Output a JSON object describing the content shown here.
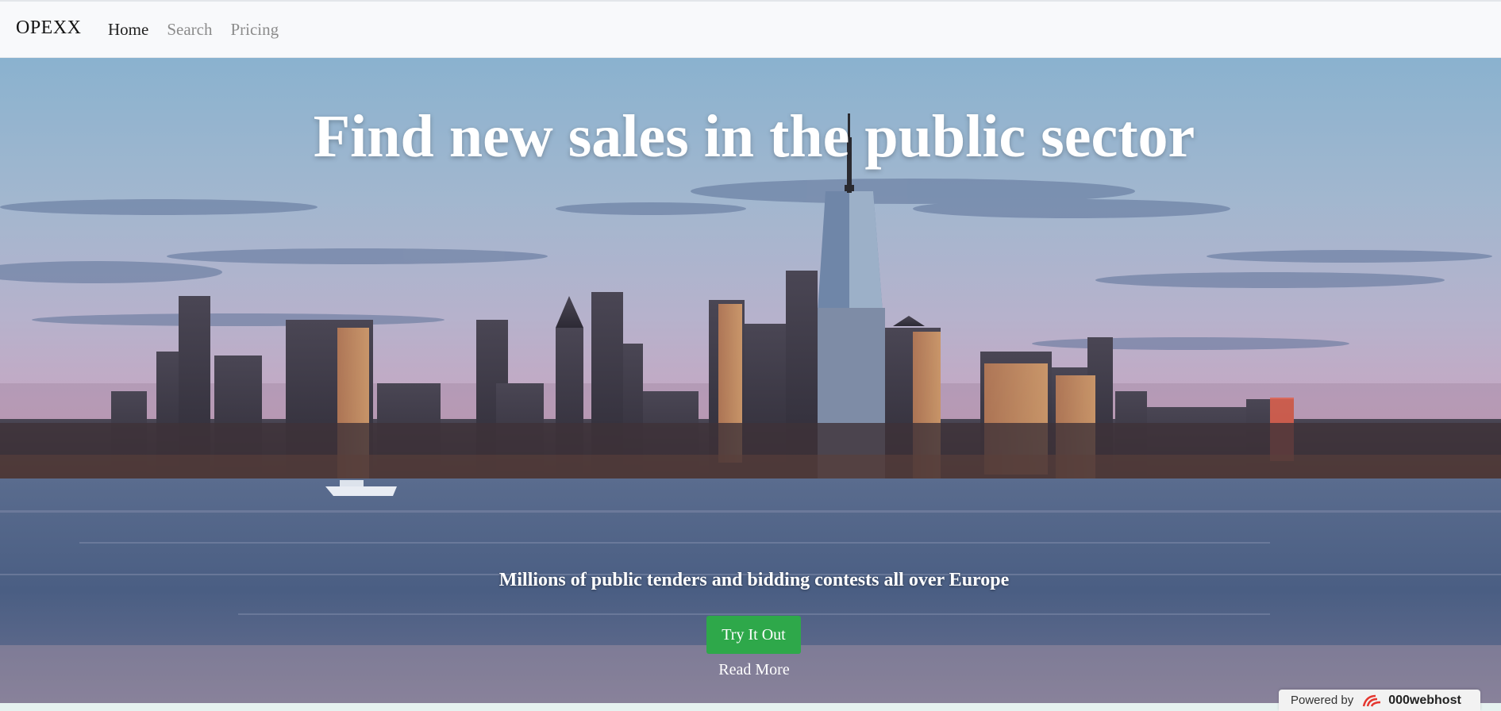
{
  "nav": {
    "brand": "OPEXX",
    "links": [
      {
        "label": "Home",
        "active": true
      },
      {
        "label": "Search",
        "active": false
      },
      {
        "label": "Pricing",
        "active": false
      }
    ]
  },
  "hero": {
    "title": "Find new sales in the public sector",
    "subtitle": "Millions of public tenders and bidding contests all over Europe",
    "cta_label": "Try It Out",
    "read_more_label": "Read More"
  },
  "badge": {
    "prefix": "Powered by",
    "brand": "000webhost"
  },
  "colors": {
    "cta": "#2ea84a",
    "nav_bg": "#f8f9fb",
    "nav_active": "#222222",
    "nav_inactive": "#8c8c8c"
  }
}
